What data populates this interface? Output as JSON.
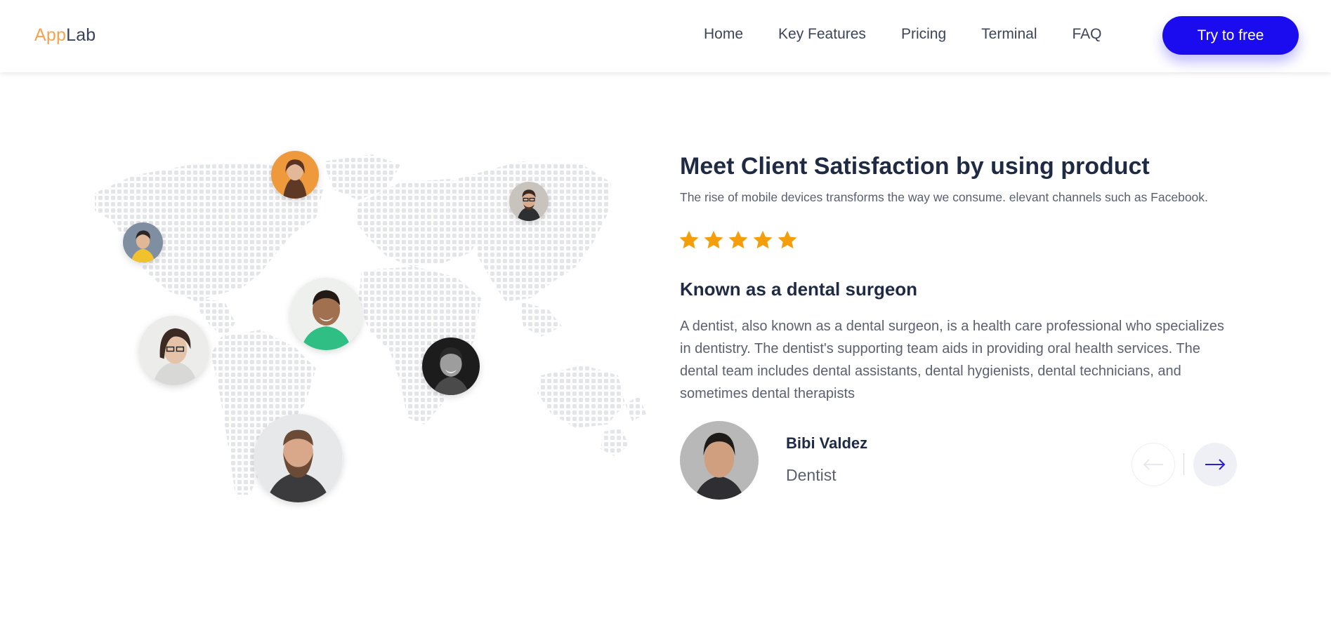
{
  "header": {
    "logo_part1": "App",
    "logo_part2": "Lab",
    "nav": [
      "Home",
      "Key Features",
      "Pricing",
      "Terminal",
      "FAQ"
    ],
    "cta_label": "Try to free"
  },
  "testimonial": {
    "title": "Meet Client Satisfaction by using product",
    "subtitle": "The rise of mobile devices transforms the way we consume. elevant channels such as Facebook.",
    "rating": 5,
    "role_heading": "Known as a dental surgeon",
    "description": "A dentist, also known as a dental surgeon, is a health care professional who specializes in dentistry. The dentist's supporting team aids in providing oral health services. The dental team includes dental assistants, dental hygienists, dental technicians, and sometimes dental therapists",
    "person": {
      "name": "Bibi Valdez",
      "title": "Dentist"
    }
  },
  "icons": {
    "star": "star-icon",
    "prev": "arrow-left-icon",
    "next": "arrow-right-icon"
  },
  "colors": {
    "accent": "#1b0cf0",
    "logo_accent": "#f4a451",
    "star": "#f59e0b",
    "heading": "#1f2a44"
  }
}
